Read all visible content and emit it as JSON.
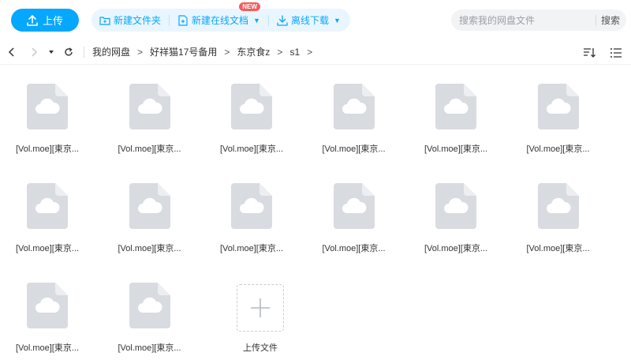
{
  "toolbar": {
    "upload_label": "上传",
    "new_folder_label": "新建文件夹",
    "new_online_doc_label": "新建在线文档",
    "new_badge": "NEW",
    "offline_download_label": "离线下载"
  },
  "search": {
    "placeholder": "搜索我的网盘文件",
    "button_label": "搜索"
  },
  "breadcrumb": {
    "items": [
      "我的网盘",
      "好祥猫17号备用",
      "东京食z",
      "s1"
    ],
    "separator": ">"
  },
  "files": [
    {
      "name": "[Vol.moe][東京..."
    },
    {
      "name": "[Vol.moe][東京..."
    },
    {
      "name": "[Vol.moe][東京..."
    },
    {
      "name": "[Vol.moe][東京..."
    },
    {
      "name": "[Vol.moe][東京..."
    },
    {
      "name": "[Vol.moe][東京..."
    },
    {
      "name": "[Vol.moe][東京..."
    },
    {
      "name": "[Vol.moe][東京..."
    },
    {
      "name": "[Vol.moe][東京..."
    },
    {
      "name": "[Vol.moe][東京..."
    },
    {
      "name": "[Vol.moe][東京..."
    },
    {
      "name": "[Vol.moe][東京..."
    },
    {
      "name": "[Vol.moe][東京..."
    },
    {
      "name": "[Vol.moe][東京..."
    }
  ],
  "upload_tile": {
    "label": "上传文件"
  },
  "colors": {
    "accent": "#06a7ff",
    "accent_light": "#eaf6ff",
    "badge": "#f25d5d",
    "file_icon": "#d8dbe0",
    "file_icon_fold": "#eceef1"
  }
}
